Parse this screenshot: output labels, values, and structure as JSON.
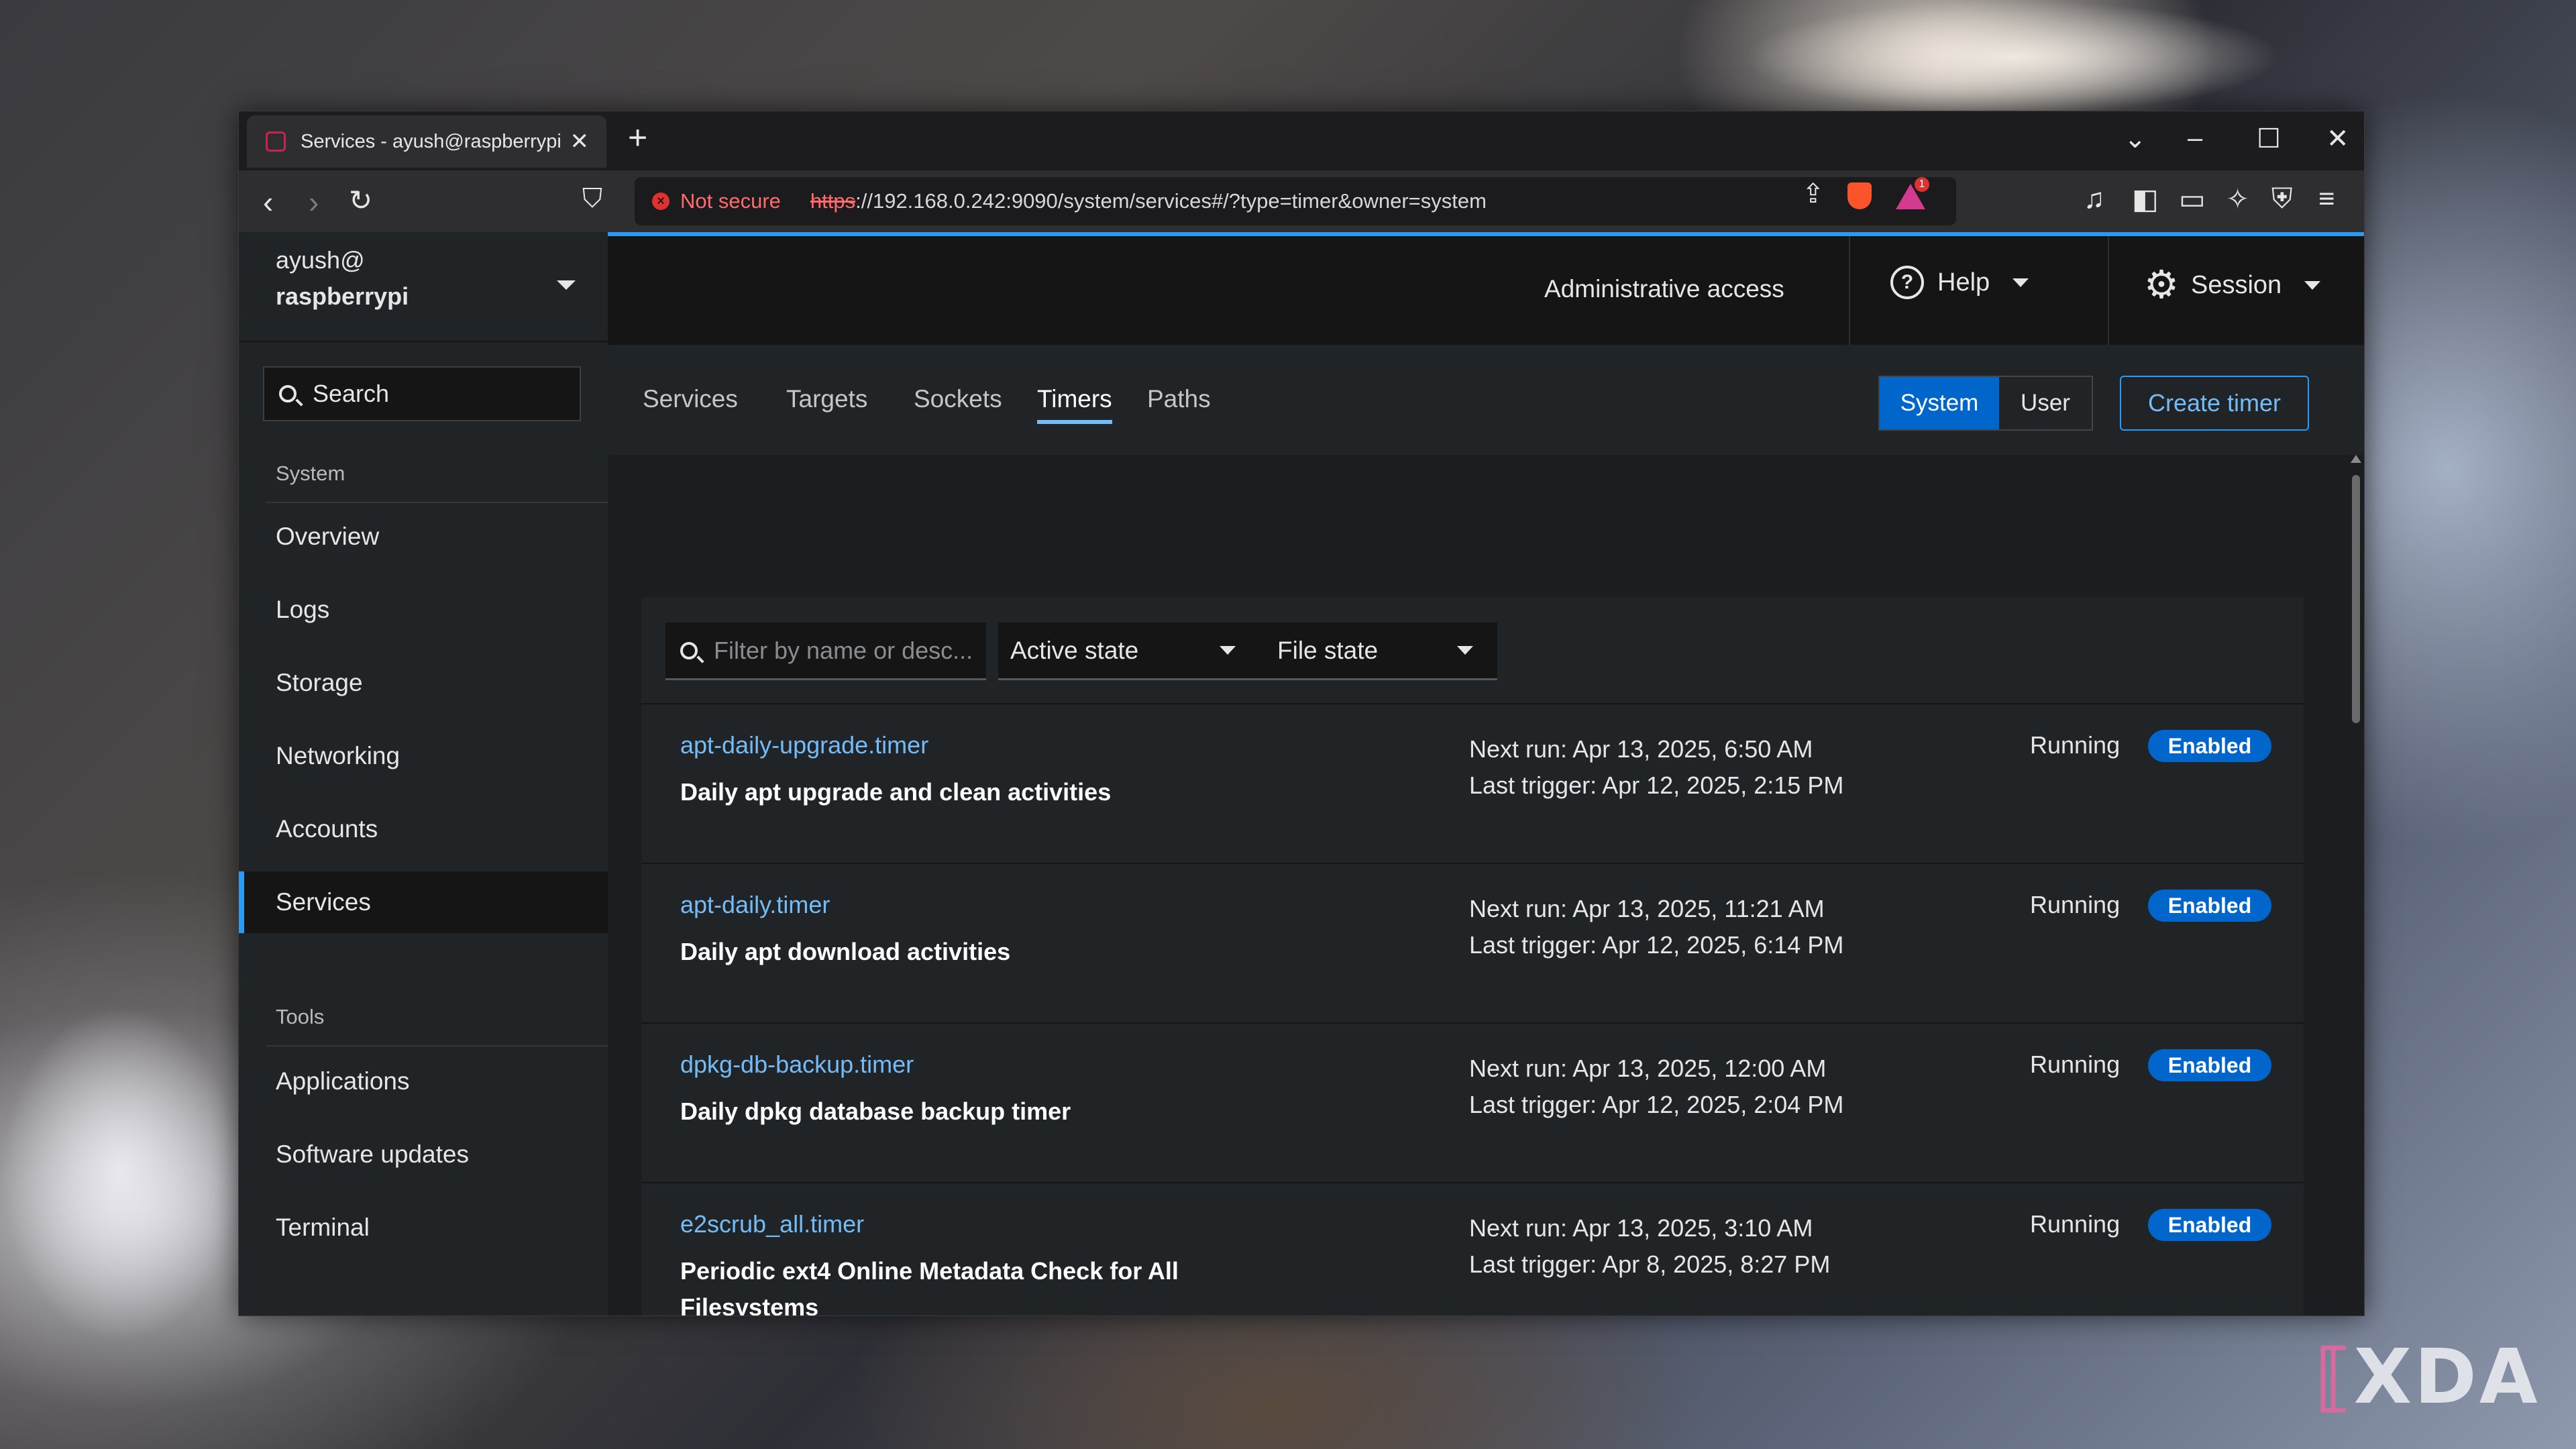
{
  "browser": {
    "tab_title": "Services - ayush@raspberrypi",
    "tab_close": "✕",
    "new_tab": "+",
    "not_secure": "Not secure",
    "url_scheme": "https",
    "url_rest": "://192.168.0.242:9090/system/services#/?type=timer&owner=system",
    "brave_badge": "1"
  },
  "sidebar": {
    "host_user": "ayush@",
    "host_name": "raspberrypi",
    "search_placeholder": "Search",
    "system_label": "System",
    "system_items": [
      "Overview",
      "Logs",
      "Storage",
      "Networking",
      "Accounts",
      "Services"
    ],
    "active_item": "Services",
    "tools_label": "Tools",
    "tools_items": [
      "Applications",
      "Software updates",
      "Terminal"
    ]
  },
  "header": {
    "admin_access": "Administrative access",
    "help": "Help",
    "session": "Session"
  },
  "subnav": {
    "tabs": [
      "Services",
      "Targets",
      "Sockets",
      "Timers",
      "Paths"
    ],
    "active_tab": "Timers",
    "toggle": [
      "System",
      "User"
    ],
    "toggle_selected": "System",
    "create_button": "Create timer"
  },
  "filters": {
    "filter_placeholder": "Filter by name or desc...",
    "active_state": "Active state",
    "file_state": "File state"
  },
  "timers": [
    {
      "name": "apt-daily-upgrade.timer",
      "description": "Daily apt upgrade and clean activities",
      "next_run": "Next run: Apr 13, 2025, 6:50 AM",
      "last_trigger": "Last trigger: Apr 12, 2025, 2:15 PM",
      "state": "Running",
      "file_state": "Enabled"
    },
    {
      "name": "apt-daily.timer",
      "description": "Daily apt download activities",
      "next_run": "Next run: Apr 13, 2025, 11:21 AM",
      "last_trigger": "Last trigger: Apr 12, 2025, 6:14 PM",
      "state": "Running",
      "file_state": "Enabled"
    },
    {
      "name": "dpkg-db-backup.timer",
      "description": "Daily dpkg database backup timer",
      "next_run": "Next run: Apr 13, 2025, 12:00 AM",
      "last_trigger": "Last trigger: Apr 12, 2025, 2:04 PM",
      "state": "Running",
      "file_state": "Enabled"
    },
    {
      "name": "e2scrub_all.timer",
      "description": "Periodic ext4 Online Metadata Check for All Filesystems",
      "next_run": "Next run: Apr 13, 2025, 3:10 AM",
      "last_trigger": "Last trigger: Apr 8, 2025, 8:27 PM",
      "state": "Running",
      "file_state": "Enabled"
    }
  ],
  "watermark": "XDA",
  "colors": {
    "accent": "#2b9af3",
    "link": "#73bcf7",
    "badge": "#0066cc",
    "insecure": "#ff6b6b"
  }
}
